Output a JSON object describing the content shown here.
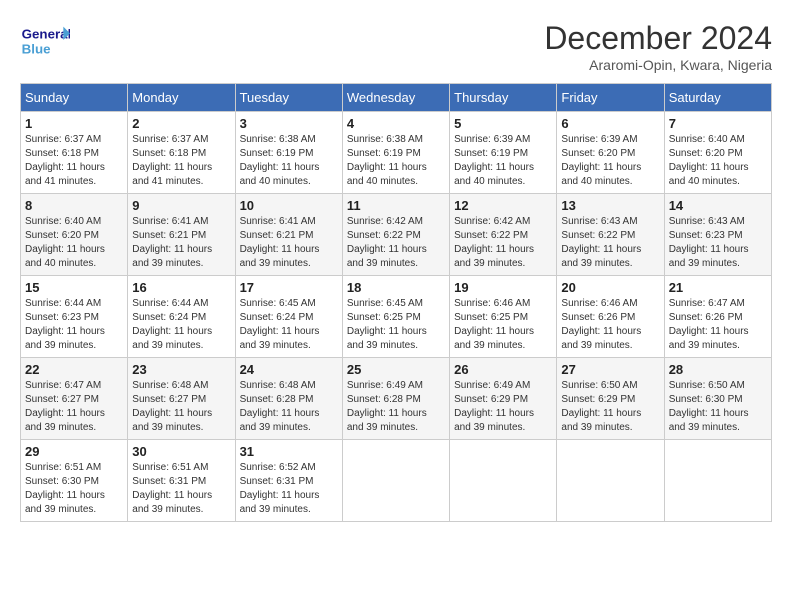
{
  "logo": {
    "text_general": "General",
    "text_blue": "Blue"
  },
  "header": {
    "month": "December 2024",
    "location": "Araromi-Opin, Kwara, Nigeria"
  },
  "weekdays": [
    "Sunday",
    "Monday",
    "Tuesday",
    "Wednesday",
    "Thursday",
    "Friday",
    "Saturday"
  ],
  "weeks": [
    [
      {
        "day": "1",
        "sunrise": "6:37 AM",
        "sunset": "6:18 PM",
        "daylight": "11 hours and 41 minutes."
      },
      {
        "day": "2",
        "sunrise": "6:37 AM",
        "sunset": "6:18 PM",
        "daylight": "11 hours and 41 minutes."
      },
      {
        "day": "3",
        "sunrise": "6:38 AM",
        "sunset": "6:19 PM",
        "daylight": "11 hours and 40 minutes."
      },
      {
        "day": "4",
        "sunrise": "6:38 AM",
        "sunset": "6:19 PM",
        "daylight": "11 hours and 40 minutes."
      },
      {
        "day": "5",
        "sunrise": "6:39 AM",
        "sunset": "6:19 PM",
        "daylight": "11 hours and 40 minutes."
      },
      {
        "day": "6",
        "sunrise": "6:39 AM",
        "sunset": "6:20 PM",
        "daylight": "11 hours and 40 minutes."
      },
      {
        "day": "7",
        "sunrise": "6:40 AM",
        "sunset": "6:20 PM",
        "daylight": "11 hours and 40 minutes."
      }
    ],
    [
      {
        "day": "8",
        "sunrise": "6:40 AM",
        "sunset": "6:20 PM",
        "daylight": "11 hours and 40 minutes."
      },
      {
        "day": "9",
        "sunrise": "6:41 AM",
        "sunset": "6:21 PM",
        "daylight": "11 hours and 39 minutes."
      },
      {
        "day": "10",
        "sunrise": "6:41 AM",
        "sunset": "6:21 PM",
        "daylight": "11 hours and 39 minutes."
      },
      {
        "day": "11",
        "sunrise": "6:42 AM",
        "sunset": "6:22 PM",
        "daylight": "11 hours and 39 minutes."
      },
      {
        "day": "12",
        "sunrise": "6:42 AM",
        "sunset": "6:22 PM",
        "daylight": "11 hours and 39 minutes."
      },
      {
        "day": "13",
        "sunrise": "6:43 AM",
        "sunset": "6:22 PM",
        "daylight": "11 hours and 39 minutes."
      },
      {
        "day": "14",
        "sunrise": "6:43 AM",
        "sunset": "6:23 PM",
        "daylight": "11 hours and 39 minutes."
      }
    ],
    [
      {
        "day": "15",
        "sunrise": "6:44 AM",
        "sunset": "6:23 PM",
        "daylight": "11 hours and 39 minutes."
      },
      {
        "day": "16",
        "sunrise": "6:44 AM",
        "sunset": "6:24 PM",
        "daylight": "11 hours and 39 minutes."
      },
      {
        "day": "17",
        "sunrise": "6:45 AM",
        "sunset": "6:24 PM",
        "daylight": "11 hours and 39 minutes."
      },
      {
        "day": "18",
        "sunrise": "6:45 AM",
        "sunset": "6:25 PM",
        "daylight": "11 hours and 39 minutes."
      },
      {
        "day": "19",
        "sunrise": "6:46 AM",
        "sunset": "6:25 PM",
        "daylight": "11 hours and 39 minutes."
      },
      {
        "day": "20",
        "sunrise": "6:46 AM",
        "sunset": "6:26 PM",
        "daylight": "11 hours and 39 minutes."
      },
      {
        "day": "21",
        "sunrise": "6:47 AM",
        "sunset": "6:26 PM",
        "daylight": "11 hours and 39 minutes."
      }
    ],
    [
      {
        "day": "22",
        "sunrise": "6:47 AM",
        "sunset": "6:27 PM",
        "daylight": "11 hours and 39 minutes."
      },
      {
        "day": "23",
        "sunrise": "6:48 AM",
        "sunset": "6:27 PM",
        "daylight": "11 hours and 39 minutes."
      },
      {
        "day": "24",
        "sunrise": "6:48 AM",
        "sunset": "6:28 PM",
        "daylight": "11 hours and 39 minutes."
      },
      {
        "day": "25",
        "sunrise": "6:49 AM",
        "sunset": "6:28 PM",
        "daylight": "11 hours and 39 minutes."
      },
      {
        "day": "26",
        "sunrise": "6:49 AM",
        "sunset": "6:29 PM",
        "daylight": "11 hours and 39 minutes."
      },
      {
        "day": "27",
        "sunrise": "6:50 AM",
        "sunset": "6:29 PM",
        "daylight": "11 hours and 39 minutes."
      },
      {
        "day": "28",
        "sunrise": "6:50 AM",
        "sunset": "6:30 PM",
        "daylight": "11 hours and 39 minutes."
      }
    ],
    [
      {
        "day": "29",
        "sunrise": "6:51 AM",
        "sunset": "6:30 PM",
        "daylight": "11 hours and 39 minutes."
      },
      {
        "day": "30",
        "sunrise": "6:51 AM",
        "sunset": "6:31 PM",
        "daylight": "11 hours and 39 minutes."
      },
      {
        "day": "31",
        "sunrise": "6:52 AM",
        "sunset": "6:31 PM",
        "daylight": "11 hours and 39 minutes."
      },
      null,
      null,
      null,
      null
    ]
  ]
}
